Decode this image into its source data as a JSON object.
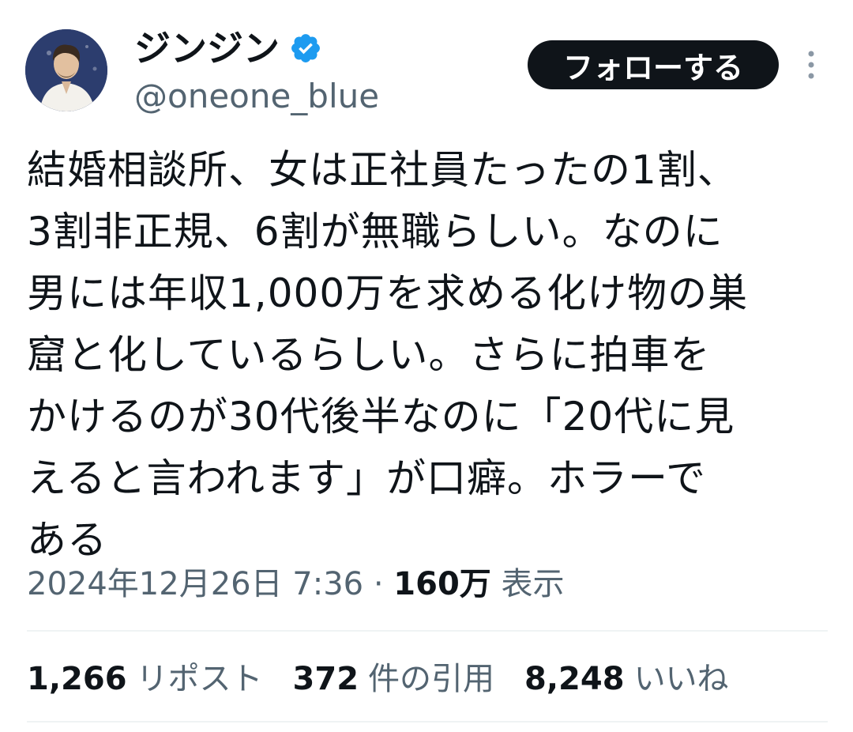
{
  "author": {
    "display_name": "ジンジン",
    "handle": "@oneone_blue",
    "verified": true,
    "avatar_icon": "avatar-illustration"
  },
  "actions": {
    "follow_label": "フォローする",
    "more_icon": "more-vertical-icon"
  },
  "tweet": {
    "lines": [
      "結婚相談所、女は正社員たったの1割、",
      "3割非正規、6割が無職らしい。なのに",
      "男には年収1,000万を求める化け物の巣",
      "窟と化しているらしい。さらに拍車を",
      "かけるのが30代後半なのに「20代に見",
      "えると言われます」が口癖。ホラーで",
      "ある"
    ]
  },
  "meta": {
    "timestamp": "2024年12月26日 7:36",
    "separator": "·",
    "views_count": "160万",
    "views_label": "表示"
  },
  "stats": [
    {
      "count": "1,266",
      "label": "リポスト"
    },
    {
      "count": "372",
      "label": "件の引用"
    },
    {
      "count": "8,248",
      "label": "いいね"
    }
  ],
  "colors": {
    "text_primary": "#0f1419",
    "text_secondary": "#536471",
    "verified_blue": "#1d9bf0",
    "follow_button_bg": "#0f1419",
    "divider": "#eff3f4"
  }
}
